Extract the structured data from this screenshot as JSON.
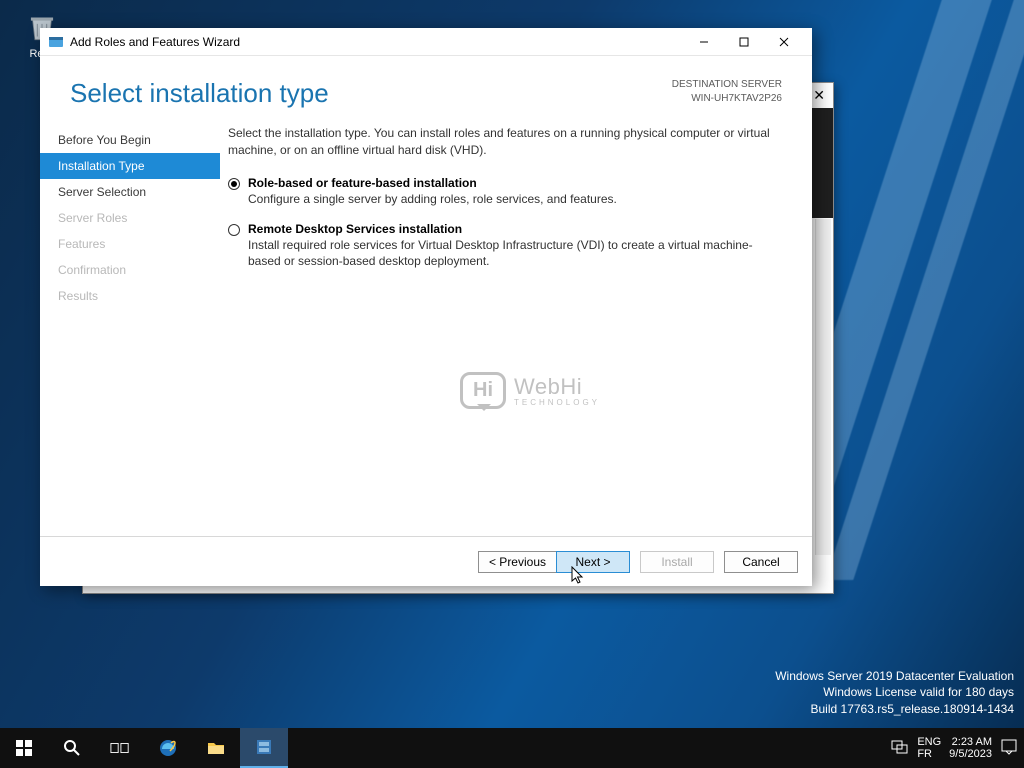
{
  "desktop": {
    "recycle_bin_label": "Recy",
    "license_lines": [
      "Windows Server 2019 Datacenter Evaluation",
      "Windows License valid for 180 days",
      "Build 17763.rs5_release.180914-1434"
    ]
  },
  "wizard": {
    "window_title": "Add Roles and Features Wizard",
    "page_title": "Select installation type",
    "destination_label": "DESTINATION SERVER",
    "destination_value": "WIN-UH7KTAV2P26",
    "steps": [
      {
        "label": "Before You Begin",
        "state": "normal"
      },
      {
        "label": "Installation Type",
        "state": "selected"
      },
      {
        "label": "Server Selection",
        "state": "normal"
      },
      {
        "label": "Server Roles",
        "state": "disabled"
      },
      {
        "label": "Features",
        "state": "disabled"
      },
      {
        "label": "Confirmation",
        "state": "disabled"
      },
      {
        "label": "Results",
        "state": "disabled"
      }
    ],
    "intro": "Select the installation type. You can install roles and features on a running physical computer or virtual machine, or on an offline virtual hard disk (VHD).",
    "options": [
      {
        "title": "Role-based or feature-based installation",
        "desc": "Configure a single server by adding roles, role services, and features.",
        "checked": true
      },
      {
        "title": "Remote Desktop Services installation",
        "desc": "Install required role services for Virtual Desktop Infrastructure (VDI) to create a virtual machine-based or session-based desktop deployment.",
        "checked": false
      }
    ],
    "buttons": {
      "previous": "< Previous",
      "next": "Next >",
      "install": "Install",
      "cancel": "Cancel"
    },
    "watermark": {
      "badge": "Hi",
      "line1": "WebHi",
      "line2": "TECHNOLOGY"
    }
  },
  "taskbar": {
    "lang1": "ENG",
    "lang2": "FR",
    "time": "2:23 AM",
    "date": "9/5/2023"
  }
}
